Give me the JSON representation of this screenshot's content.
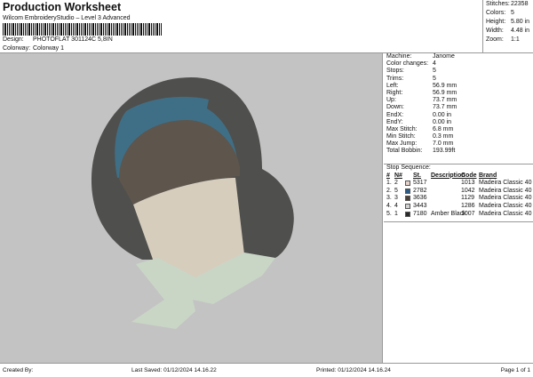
{
  "header": {
    "title": "Production Worksheet",
    "subtitle": "Wilcom EmbroideryStudio – Level 3 Advanced",
    "design_label": "Design:",
    "design": "PHOTOFLAT 301124C 5,8IN",
    "colorway_label": "Colorway:",
    "colorway": "Colorway 1"
  },
  "stats": [
    {
      "k": "Stitches:",
      "v": "22358"
    },
    {
      "k": "Colors:",
      "v": "5"
    },
    {
      "k": "Height:",
      "v": "5.80 in"
    },
    {
      "k": "Width:",
      "v": "4.48 in"
    },
    {
      "k": "Zoom:",
      "v": "1:1"
    }
  ],
  "info": [
    {
      "k": "Machine:",
      "v": "Janome"
    },
    {
      "k": "Color changes:",
      "v": "4"
    },
    {
      "k": "Stops:",
      "v": "5"
    },
    {
      "k": "Trims:",
      "v": "5"
    },
    {
      "k": "Left:",
      "v": "56.9 mm"
    },
    {
      "k": "Right:",
      "v": "56.9 mm"
    },
    {
      "k": "Up:",
      "v": "73.7 mm"
    },
    {
      "k": "Down:",
      "v": "73.7 mm"
    },
    {
      "k": "EndX:",
      "v": "0.00 in"
    },
    {
      "k": "EndY:",
      "v": "0.00 in"
    },
    {
      "k": "Max Stitch:",
      "v": "6.8 mm"
    },
    {
      "k": "Min Stitch:",
      "v": "0.3 mm"
    },
    {
      "k": "Max Jump:",
      "v": "7.0 mm"
    },
    {
      "k": "Total Bobbin:",
      "v": "193.99ft"
    }
  ],
  "sequence": {
    "title": "Stop Sequence:",
    "headers": [
      "#",
      "N#",
      "St.",
      "Description",
      "Code",
      "Brand"
    ],
    "rows": [
      {
        "n": "1.",
        "num": "2",
        "color": "#e6d2cc",
        "st": "5317",
        "desc": "",
        "code": "1013",
        "brand": "Madeira Classic 40"
      },
      {
        "n": "2.",
        "num": "5",
        "color": "#2c5a86",
        "st": "2782",
        "desc": "",
        "code": "1042",
        "brand": "Madeira Classic 40"
      },
      {
        "n": "3.",
        "num": "3",
        "color": "#4a4039",
        "st": "3636",
        "desc": "",
        "code": "1129",
        "brand": "Madeira Classic 40"
      },
      {
        "n": "4.",
        "num": "4",
        "color": "#d2d2d2",
        "st": "3443",
        "desc": "",
        "code": "1286",
        "brand": "Madeira Classic 40"
      },
      {
        "n": "5.",
        "num": "1",
        "color": "#2a2a2a",
        "st": "7180",
        "desc": "Amber Black",
        "code": "1007",
        "brand": "Madeira Classic 40"
      }
    ]
  },
  "footer": {
    "created": "Created By:",
    "saved": "Last Saved: 01/12/2024 14.16.22",
    "printed": "Printed: 01/12/2024 14.16.24",
    "page": "Page 1 of 1"
  },
  "colors": {
    "preview_bg": "#c3c3c3",
    "hair": "#4f4f4d",
    "band": "#3f6f86",
    "cap": "#5e554c",
    "face": "#d6cdbd",
    "scarf": "#c9d6c6"
  }
}
